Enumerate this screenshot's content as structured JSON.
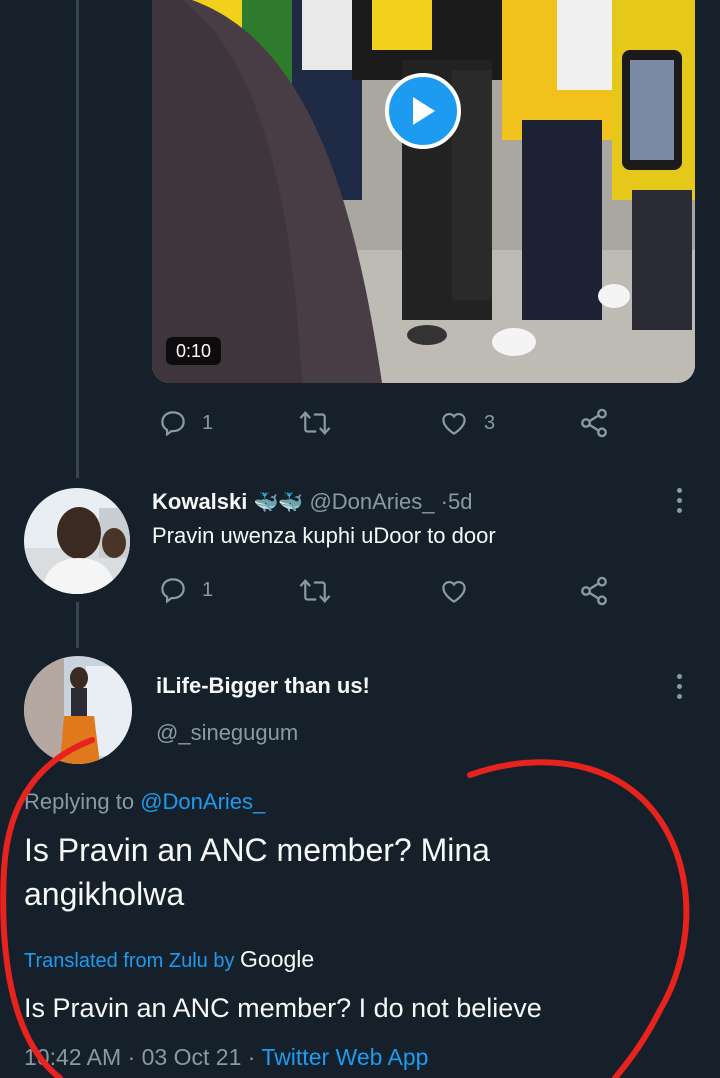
{
  "video": {
    "duration": "0:10"
  },
  "top_tweet_actions": {
    "reply_count": "1",
    "retweet_count": "",
    "like_count": "3"
  },
  "reply": {
    "name": "Kowalski",
    "emoji": "🐳🐳",
    "handle": "@DonAries_",
    "separator": "·",
    "age": "5d",
    "text": "Pravin uwenza kuphi uDoor to door",
    "reply_count": "1"
  },
  "main_tweet": {
    "name": "iLife-Bigger than us!",
    "handle": "@_sinegugum",
    "replying_prefix": "Replying to",
    "replying_to": "@DonAries_",
    "text_line1": "Is Pravin an ANC member? Mina",
    "text_line2": "angikholwa",
    "translated_label": "Translated from Zulu by",
    "translator": "Google",
    "translation": "Is Pravin an ANC member? I do not believe",
    "time": "10:42 AM",
    "dot1": "·",
    "date": "03 Oct 21",
    "dot2": "·",
    "source": "Twitter Web App"
  },
  "colors": {
    "background": "#15202b",
    "accent": "#1d9bf0",
    "muted": "#8b98a5",
    "annotation": "#e8221c"
  }
}
